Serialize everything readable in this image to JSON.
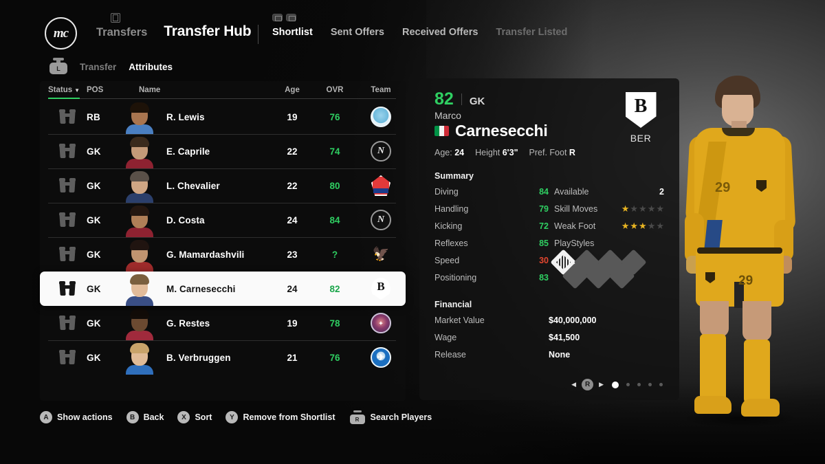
{
  "brand": {
    "logo_text": "mc"
  },
  "nav": {
    "items": [
      {
        "label": "Transfers",
        "active": false
      },
      {
        "label": "Transfer Hub",
        "active": true
      }
    ],
    "tabs": [
      {
        "label": "Shortlist",
        "state": "active"
      },
      {
        "label": "Sent Offers",
        "state": "normal"
      },
      {
        "label": "Received Offers",
        "state": "normal"
      },
      {
        "label": "Transfer Listed",
        "state": "dim"
      }
    ]
  },
  "subtabs": {
    "trigger_icon": "trigger-button-icon",
    "trigger_label": "L",
    "items": [
      {
        "label": "Transfer",
        "active": false
      },
      {
        "label": "Attributes",
        "active": true
      }
    ]
  },
  "list": {
    "columns": {
      "status": "Status",
      "sort_caret": "▼",
      "pos": "POS",
      "name": "Name",
      "age": "Age",
      "ovr": "OVR",
      "team": "Team"
    },
    "rows": [
      {
        "pos": "RB",
        "name": "R. Lewis",
        "age": "19",
        "ovr": "76",
        "team": "MCI",
        "crest": "crest-mci",
        "crest_glyph": "",
        "selected": false,
        "hair": "#1d1208",
        "skin": "#a9754f",
        "kit": "#4a7fc1"
      },
      {
        "pos": "GK",
        "name": "E. Caprile",
        "age": "22",
        "ovr": "74",
        "team": "NAP",
        "crest": "crest-nap",
        "crest_glyph": "N",
        "selected": false,
        "hair": "#3a2a1c",
        "skin": "#c49a78",
        "kit": "#8e2231"
      },
      {
        "pos": "GK",
        "name": "L. Chevalier",
        "age": "22",
        "ovr": "80",
        "team": "LIL",
        "crest": "crest-lil",
        "crest_glyph": "",
        "selected": false,
        "hair": "#5a5048",
        "skin": "#cfa684",
        "kit": "#2b3f6b"
      },
      {
        "pos": "GK",
        "name": "D. Costa",
        "age": "24",
        "ovr": "84",
        "team": "NAP",
        "crest": "crest-nap",
        "crest_glyph": "N",
        "selected": false,
        "hair": "#241710",
        "skin": "#b07f57",
        "kit": "#8e2231"
      },
      {
        "pos": "GK",
        "name": "G. Mamardashvili",
        "age": "23",
        "ovr": "?",
        "team": "LFC",
        "crest": "crest-lfc",
        "crest_glyph": "🦅",
        "selected": false,
        "hair": "#201410",
        "skin": "#c09470",
        "kit": "#9e2b2b"
      },
      {
        "pos": "GK",
        "name": "M. Carnesecchi",
        "age": "24",
        "ovr": "82",
        "team": "BER",
        "crest": "crest-ber",
        "crest_glyph": "B",
        "selected": true,
        "hair": "#7a5f3e",
        "skin": "#e2bc9a",
        "kit": "#3a4f86"
      },
      {
        "pos": "GK",
        "name": "G. Restes",
        "age": "19",
        "ovr": "78",
        "team": "TFC",
        "crest": "crest-tfc",
        "crest_glyph": "✦",
        "selected": false,
        "hair": "#120c08",
        "skin": "#6b4a31",
        "kit": "#a02a3c"
      },
      {
        "pos": "GK",
        "name": "B. Verbruggen",
        "age": "21",
        "ovr": "76",
        "team": "BHA",
        "crest": "crest-bha",
        "crest_glyph": "✈",
        "selected": false,
        "hair": "#c8a36a",
        "skin": "#e0bb97",
        "kit": "#2f6fbc"
      }
    ]
  },
  "player": {
    "ovr": "82",
    "position": "GK",
    "first_name": "Marco",
    "last_name": "Carnesecchi",
    "nationality_flag": "italy-flag",
    "age_label": "Age:",
    "age_value": "24",
    "height_label": "Height",
    "height_value": "6'3\"",
    "foot_label": "Pref. Foot",
    "foot_value": "R",
    "club_badge_glyph": "B",
    "club_abbr": "BER",
    "summary_title": "Summary",
    "attributes": [
      {
        "label": "Diving",
        "value": "84",
        "tone": "high"
      },
      {
        "label": "Handling",
        "value": "79",
        "tone": "high"
      },
      {
        "label": "Kicking",
        "value": "72",
        "tone": "high"
      },
      {
        "label": "Reflexes",
        "value": "85",
        "tone": "high"
      },
      {
        "label": "Speed",
        "value": "30",
        "tone": "low"
      },
      {
        "label": "Positioning",
        "value": "83",
        "tone": "high"
      }
    ],
    "available_label": "Available",
    "available_value": "2",
    "skill_moves_label": "Skill Moves",
    "skill_moves": 1,
    "weak_foot_label": "Weak Foot",
    "weak_foot": 3,
    "playstyles_label": "PlayStyles",
    "playstyles_filled": 1,
    "playstyles_total": 7,
    "financial_title": "Financial",
    "financial": [
      {
        "label": "Market Value",
        "value": "$40,000,000"
      },
      {
        "label": "Wage",
        "value": "$41,500"
      },
      {
        "label": "Release",
        "value": "None"
      }
    ],
    "pager": {
      "left_arrow": "◀",
      "button": "R",
      "right_arrow": "▶",
      "pages": 5,
      "active_page": 1
    }
  },
  "actions": [
    {
      "glyph": "A",
      "label": "Show actions",
      "type": "button"
    },
    {
      "glyph": "B",
      "label": "Back",
      "type": "button"
    },
    {
      "glyph": "X",
      "label": "Sort",
      "type": "button"
    },
    {
      "glyph": "Y",
      "label": "Remove from Shortlist",
      "type": "button"
    },
    {
      "glyph": "R",
      "label": "Search Players",
      "type": "trigger"
    }
  ],
  "colors": {
    "accent_green": "#2fcf62",
    "low_red": "#e3462f",
    "star_gold": "#e8b422",
    "selected_row_bg": "#fafafa"
  },
  "render": {
    "shirt_number": "29"
  }
}
